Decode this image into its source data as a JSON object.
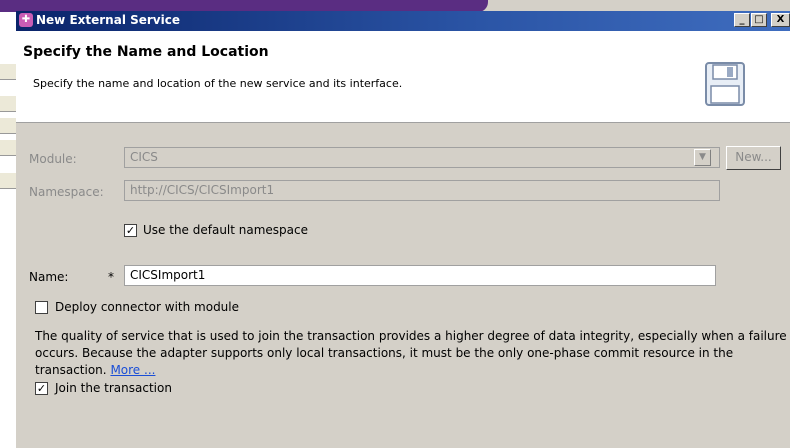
{
  "window": {
    "title": "New External Service",
    "controls": {
      "minimize": "_",
      "maximize": "□",
      "close": "X"
    }
  },
  "banner": {
    "title": "Specify the Name and Location",
    "description": "Specify the name and location of the new service and its interface.",
    "icon": "save-disk-icon"
  },
  "form": {
    "module": {
      "label": "Module:",
      "value": "CICS",
      "new_button": "New..."
    },
    "namespace": {
      "label": "Namespace:",
      "value": "http://CICS/CICSImport1"
    },
    "use_default_namespace": {
      "label": "Use the default namespace",
      "checked": true
    },
    "name": {
      "label": "Name:",
      "required_marker": "*",
      "value": "CICSImport1"
    },
    "deploy_connector": {
      "label": "Deploy connector with module",
      "checked": false
    },
    "quality_text": "The quality of service that is used to join the transaction provides a higher degree of data integrity, especially when a failure occurs. Because the adapter supports only local transactions, it must be the only one-phase commit resource in the transaction.",
    "more_link": "More ...",
    "join_transaction": {
      "label": "Join the transaction",
      "checked": true
    }
  },
  "colors": {
    "titlebar": "#0a246a",
    "dialog_bg": "#d4d0c8",
    "link": "#1a4ed6"
  }
}
